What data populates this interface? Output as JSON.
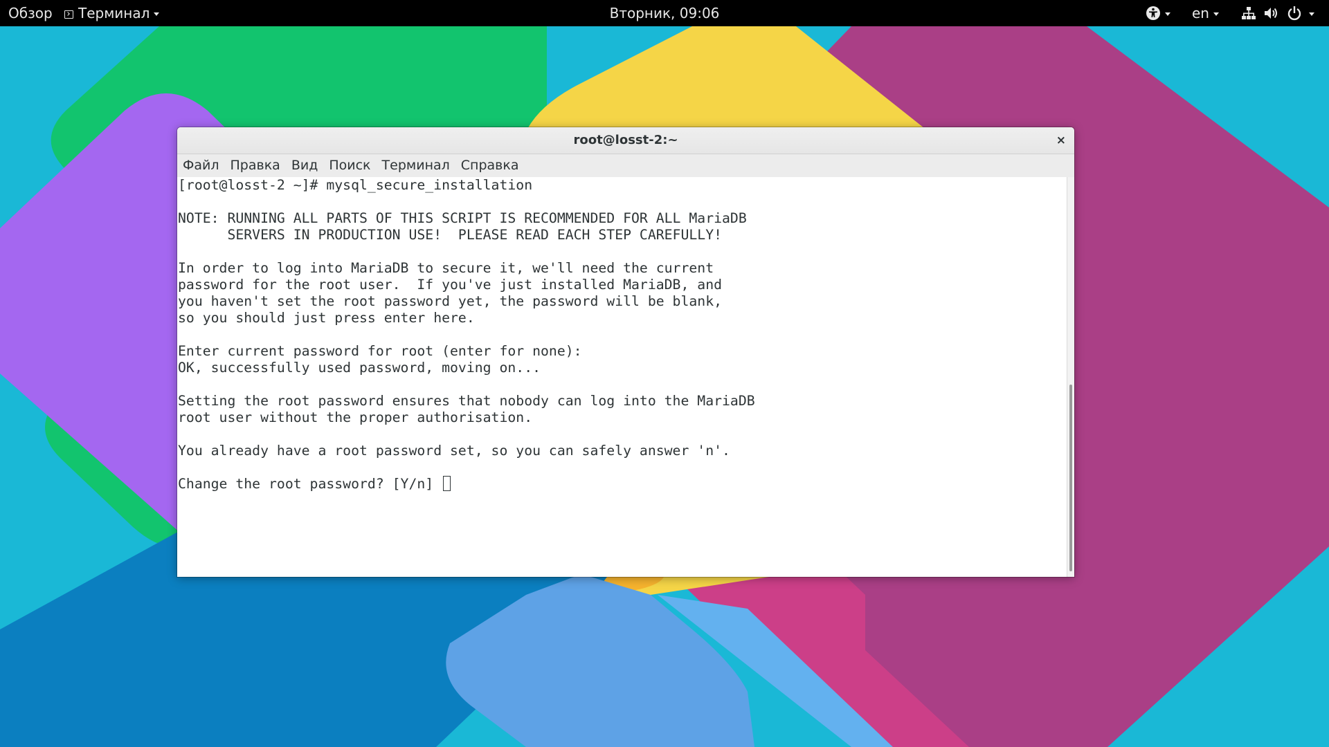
{
  "topbar": {
    "activities": "Обзор",
    "app_menu": "Терминал",
    "clock": "Вторник, 09:06",
    "language": "en"
  },
  "icons": {
    "accessibility": "accessibility-icon",
    "network": "network-icon",
    "volume": "volume-icon",
    "power": "power-icon",
    "terminal": "terminal-icon"
  },
  "colors": {
    "wallpaper_base": "#1ab8d6",
    "green": "#12c46e",
    "yellow": "#f5d547",
    "purple": "#a467f0",
    "magenta": "#aa3f86",
    "blue": "#0b7fc0"
  },
  "window": {
    "title": "root@losst-2:~",
    "close": "×",
    "menu": [
      "Файл",
      "Правка",
      "Вид",
      "Поиск",
      "Терминал",
      "Справка"
    ]
  },
  "terminal": {
    "lines": [
      "[root@losst-2 ~]# mysql_secure_installation",
      "",
      "NOTE: RUNNING ALL PARTS OF THIS SCRIPT IS RECOMMENDED FOR ALL MariaDB",
      "      SERVERS IN PRODUCTION USE!  PLEASE READ EACH STEP CAREFULLY!",
      "",
      "In order to log into MariaDB to secure it, we'll need the current",
      "password for the root user.  If you've just installed MariaDB, and",
      "you haven't set the root password yet, the password will be blank,",
      "so you should just press enter here.",
      "",
      "Enter current password for root (enter for none):",
      "OK, successfully used password, moving on...",
      "",
      "Setting the root password ensures that nobody can log into the MariaDB",
      "root user without the proper authorisation.",
      "",
      "You already have a root password set, so you can safely answer 'n'.",
      "",
      "Change the root password? [Y/n] "
    ]
  }
}
